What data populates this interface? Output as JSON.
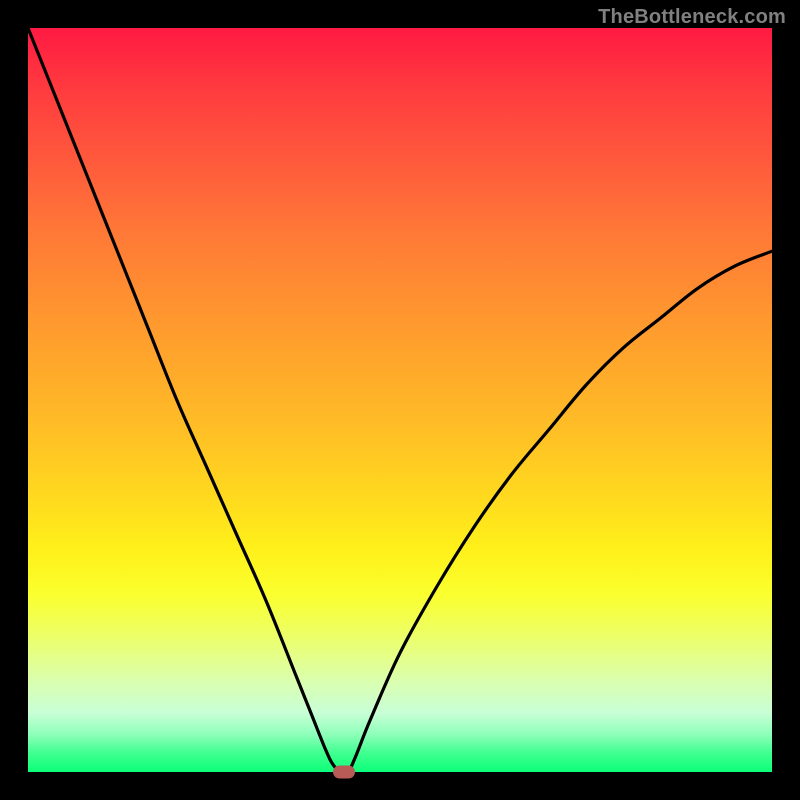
{
  "watermark": "TheBottleneck.com",
  "colors": {
    "frame": "#000000",
    "curve_stroke": "#000000",
    "marker": "#b85a55",
    "gradient_top": "#ff1a42",
    "gradient_bottom": "#0bff79",
    "watermark": "#808080"
  },
  "chart_data": {
    "type": "line",
    "title": "",
    "xlabel": "",
    "ylabel": "",
    "xlim": [
      0,
      100
    ],
    "ylim": [
      0,
      100
    ],
    "grid": false,
    "legend_position": "none",
    "series": [
      {
        "name": "bottleneck-curve",
        "x": [
          0,
          4,
          8,
          12,
          16,
          20,
          24,
          28,
          32,
          36,
          38,
          40,
          41,
          42,
          43,
          44,
          46,
          50,
          55,
          60,
          65,
          70,
          75,
          80,
          85,
          90,
          95,
          100
        ],
        "y": [
          100,
          90,
          80,
          70,
          60,
          50,
          41,
          32,
          23,
          13,
          8,
          3,
          1,
          0,
          0,
          2,
          7,
          16,
          25,
          33,
          40,
          46,
          52,
          57,
          61,
          65,
          68,
          70
        ]
      }
    ],
    "annotations": [
      {
        "name": "optimal-marker",
        "x": 42.5,
        "y": 0
      }
    ]
  }
}
